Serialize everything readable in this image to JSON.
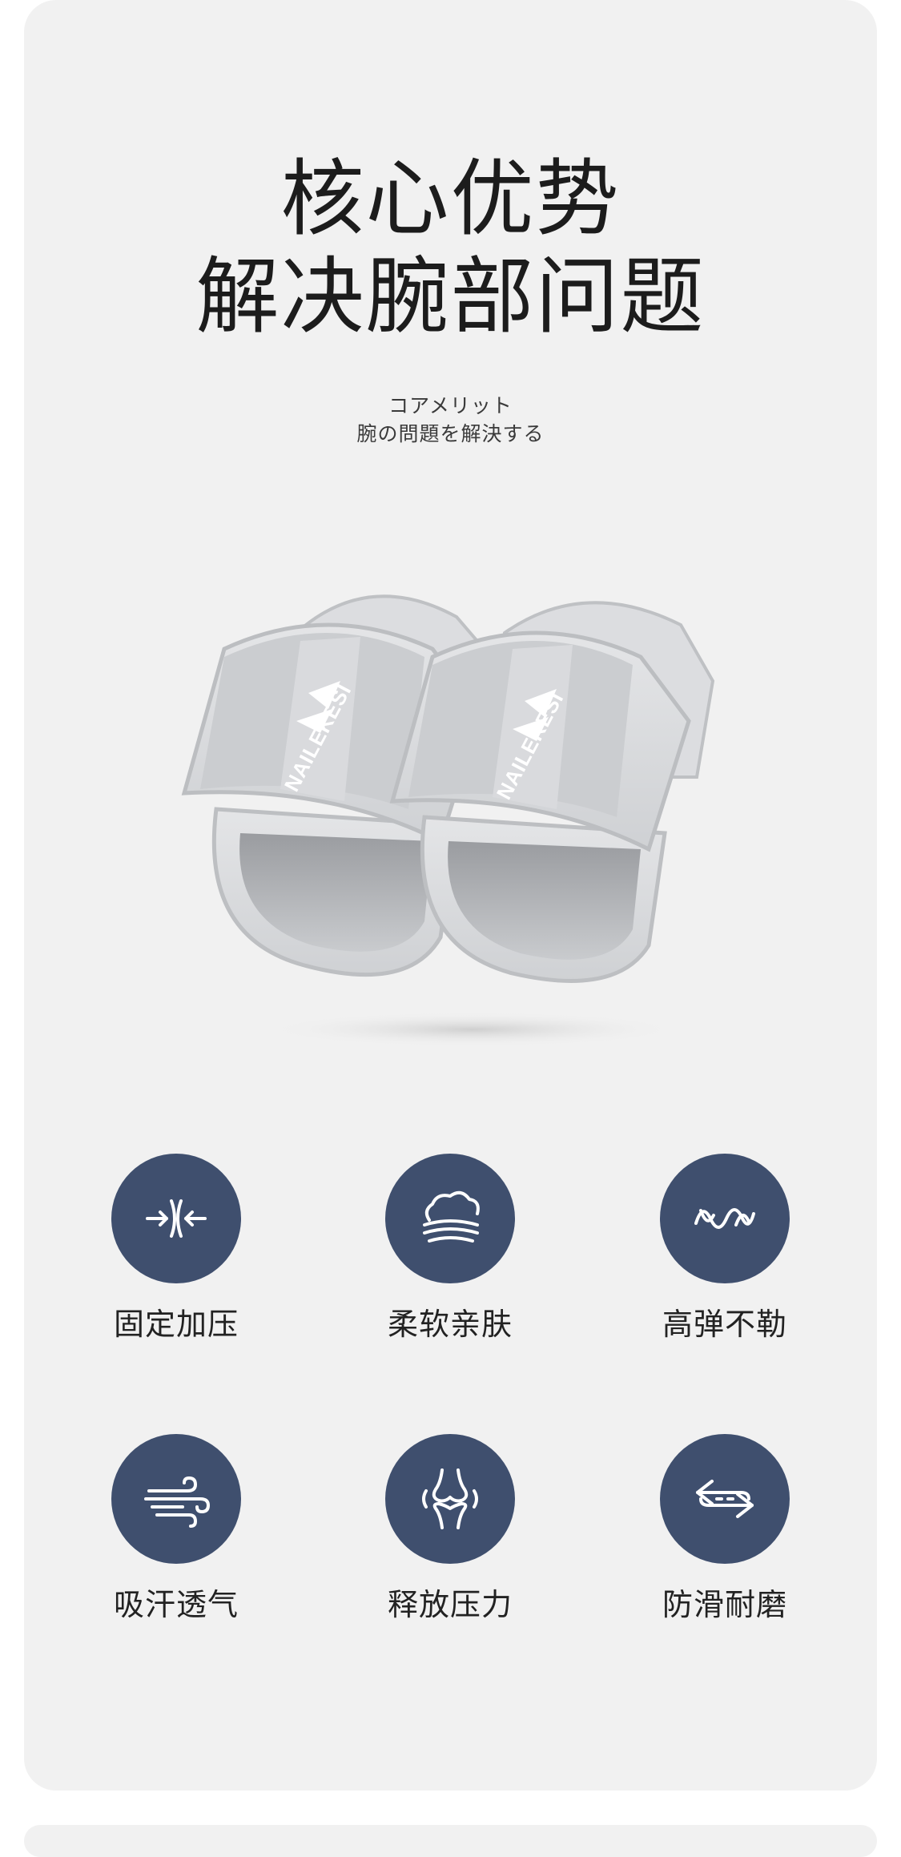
{
  "header": {
    "title_line1": "核心优势",
    "title_line2": "解决腕部问题",
    "subtitle_line1": "コアメリット",
    "subtitle_line2": "腕の問題を解決する"
  },
  "product": {
    "brand_text": "NAILEKESI",
    "logo_letter": "S"
  },
  "features": [
    {
      "label": "固定加压",
      "icon": "compress-arrows-icon"
    },
    {
      "label": "柔软亲肤",
      "icon": "soft-cloud-icon"
    },
    {
      "label": "高弹不勒",
      "icon": "elastic-wave-icon"
    },
    {
      "label": "吸汗透气",
      "icon": "breathable-wind-icon"
    },
    {
      "label": "释放压力",
      "icon": "joint-relief-icon"
    },
    {
      "label": "防滑耐磨",
      "icon": "anti-slip-arrows-icon"
    }
  ],
  "colors": {
    "card_background": "#f1f1f1",
    "icon_circle": "#3f4f6e",
    "title_text": "#1c1c1c"
  }
}
